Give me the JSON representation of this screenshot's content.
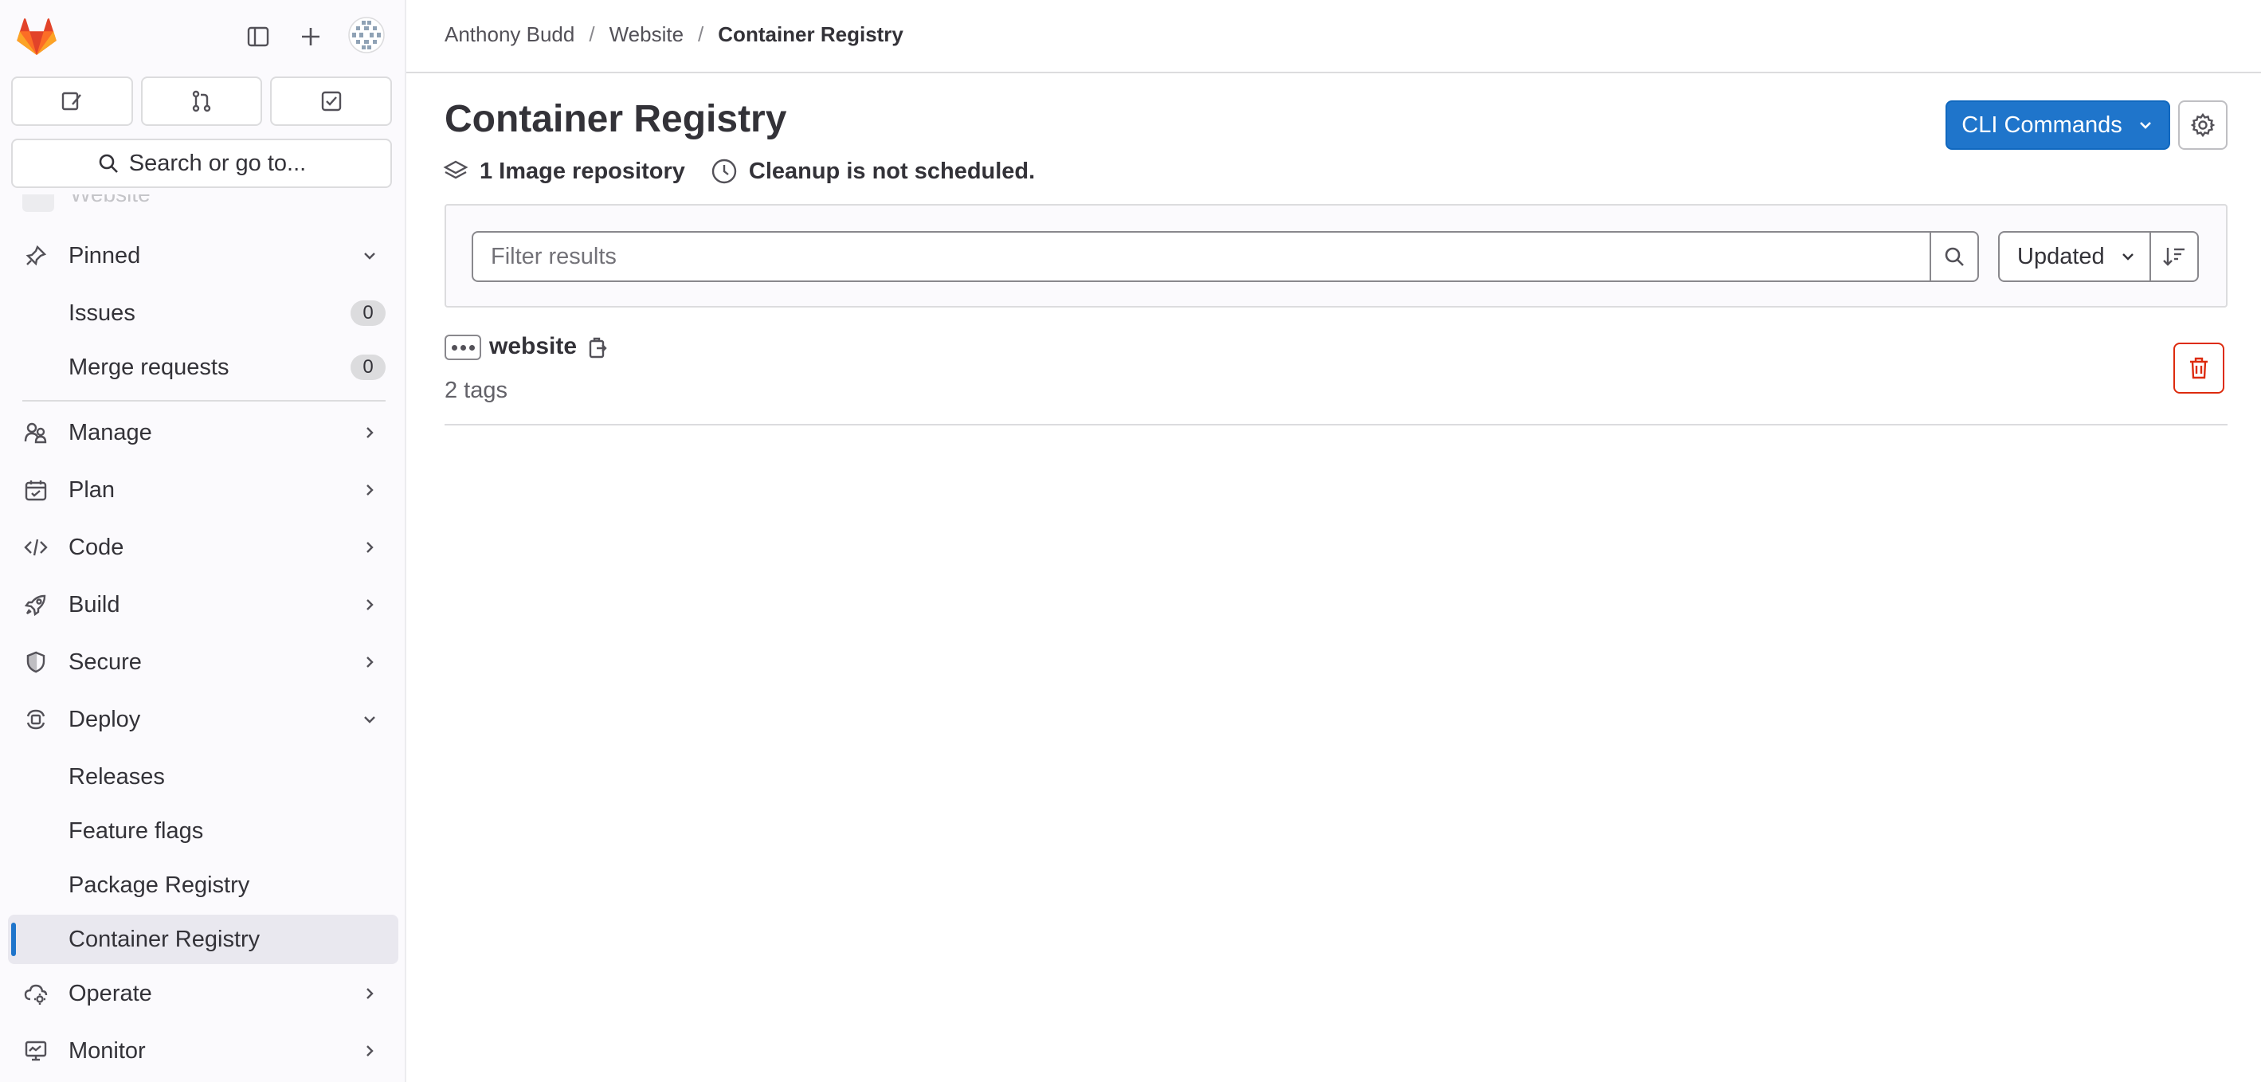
{
  "colors": {
    "primary": "#1f75cb",
    "danger": "#dd2b0e",
    "sidebar_bg": "#fbfafd",
    "active_item_bg": "#e9e8ef",
    "text": "#333238"
  },
  "sidebar": {
    "search_label": "Search or go to...",
    "ghost_label": "Website",
    "pinned": {
      "label": "Pinned",
      "items": [
        {
          "label": "Issues",
          "count": "0"
        },
        {
          "label": "Merge requests",
          "count": "0"
        }
      ]
    },
    "nav": [
      {
        "label": "Manage",
        "icon": "users-icon"
      },
      {
        "label": "Plan",
        "icon": "calendar-icon"
      },
      {
        "label": "Code",
        "icon": "code-icon"
      },
      {
        "label": "Build",
        "icon": "rocket-icon"
      },
      {
        "label": "Secure",
        "icon": "shield-icon"
      },
      {
        "label": "Deploy",
        "icon": "deployments-icon"
      }
    ],
    "deploy_items": [
      {
        "label": "Releases"
      },
      {
        "label": "Feature flags"
      },
      {
        "label": "Package Registry"
      },
      {
        "label": "Container Registry",
        "active": true
      }
    ],
    "nav_after": [
      {
        "label": "Operate",
        "icon": "cloud-gear-icon"
      },
      {
        "label": "Monitor",
        "icon": "monitor-icon"
      }
    ]
  },
  "breadcrumb": [
    "Anthony Budd",
    "Website",
    "Container Registry"
  ],
  "page": {
    "title": "Container Registry",
    "meta_repos": "1 Image repository",
    "meta_cleanup": "Cleanup is not scheduled.",
    "cli_label": "CLI Commands"
  },
  "filter": {
    "placeholder": "Filter results",
    "sort_label": "Updated"
  },
  "repositories": [
    {
      "name": "website",
      "tags": "2 tags"
    }
  ]
}
